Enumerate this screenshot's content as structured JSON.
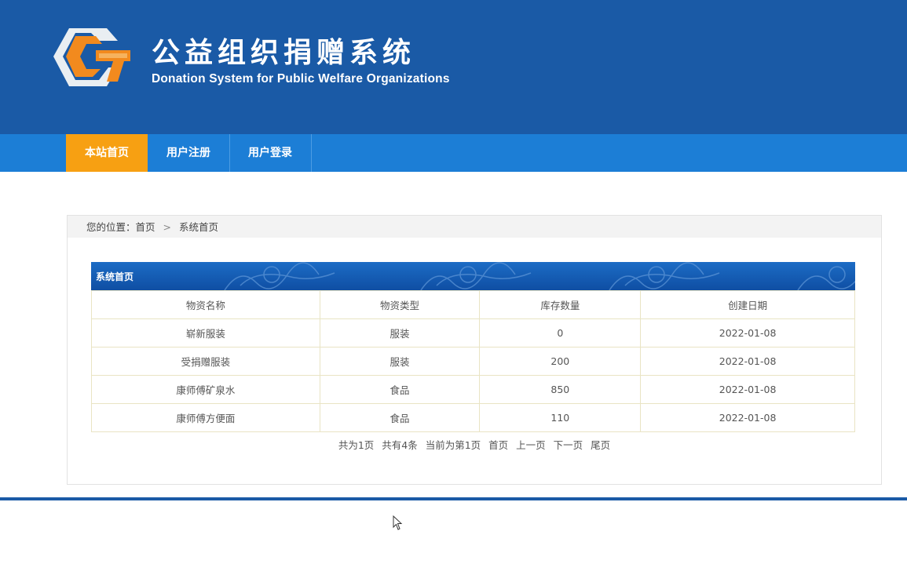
{
  "header": {
    "title": "公益组织捐赠系统",
    "subtitle": "Donation System for Public Welfare Organizations",
    "logo_icon": "donation-logo-icon"
  },
  "nav": {
    "items": [
      {
        "label": "本站首页",
        "active": true
      },
      {
        "label": "用户注册",
        "active": false
      },
      {
        "label": "用户登录",
        "active": false
      }
    ]
  },
  "breadcrumb": {
    "prefix": "您的位置：",
    "home": "首页",
    "separator": ">",
    "current": "系统首页"
  },
  "section": {
    "title": "系统首页"
  },
  "table": {
    "headers": [
      "物资名称",
      "物资类型",
      "库存数量",
      "创建日期"
    ],
    "rows": [
      [
        "崭新服装",
        "服装",
        "0",
        "2022-01-08"
      ],
      [
        "受捐赠服装",
        "服装",
        "200",
        "2022-01-08"
      ],
      [
        "康师傅矿泉水",
        "食品",
        "850",
        "2022-01-08"
      ],
      [
        "康师傅方便面",
        "食品",
        "110",
        "2022-01-08"
      ]
    ]
  },
  "pager": {
    "total_pages": "共为1页",
    "total_items": "共有4条",
    "current_page": "当前为第1页",
    "first": "首页",
    "prev": "上一页",
    "next": "下一页",
    "last": "尾页"
  },
  "colors": {
    "header_bg": "#1a5aa6",
    "nav_bg": "#1c7ed6",
    "nav_active": "#f7a012",
    "logo_orange": "#f28a1e"
  }
}
